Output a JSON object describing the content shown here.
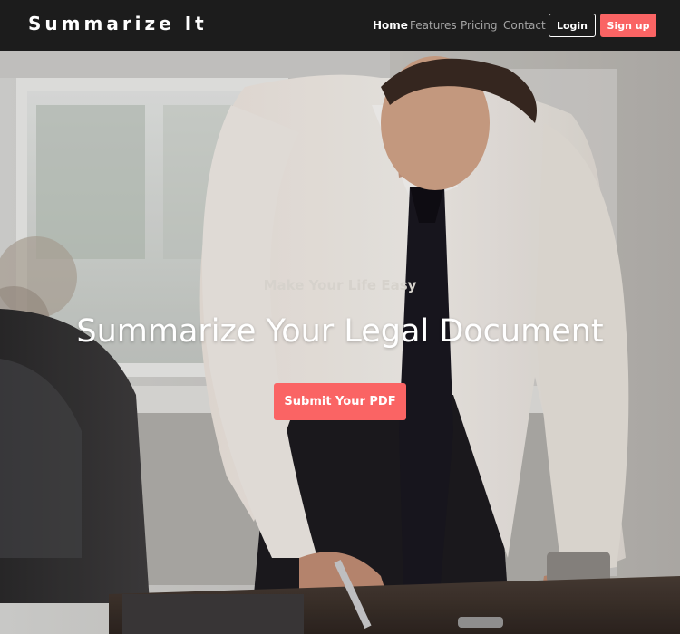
{
  "brand": {
    "name": "Summarize It"
  },
  "nav": {
    "links": [
      {
        "label": "Home",
        "active": true
      },
      {
        "label": "Features",
        "active": false
      },
      {
        "label": "Pricing",
        "active": false
      },
      {
        "label": "Contact",
        "active": false
      }
    ],
    "login_label": "Login",
    "signup_label": "Sign up"
  },
  "hero": {
    "eyebrow": "Make Your Life Easy",
    "title": "Summarize Your Legal Document",
    "cta_label": "Submit Your PDF",
    "background_image": "man-in-white-shirt-and-black-tie-signing-document-at-desk"
  },
  "colors": {
    "navbar_bg": "#1c1c1c",
    "accent": "#fa6464",
    "text_light": "#ffffff",
    "nav_inactive": "#a4a4a4"
  }
}
